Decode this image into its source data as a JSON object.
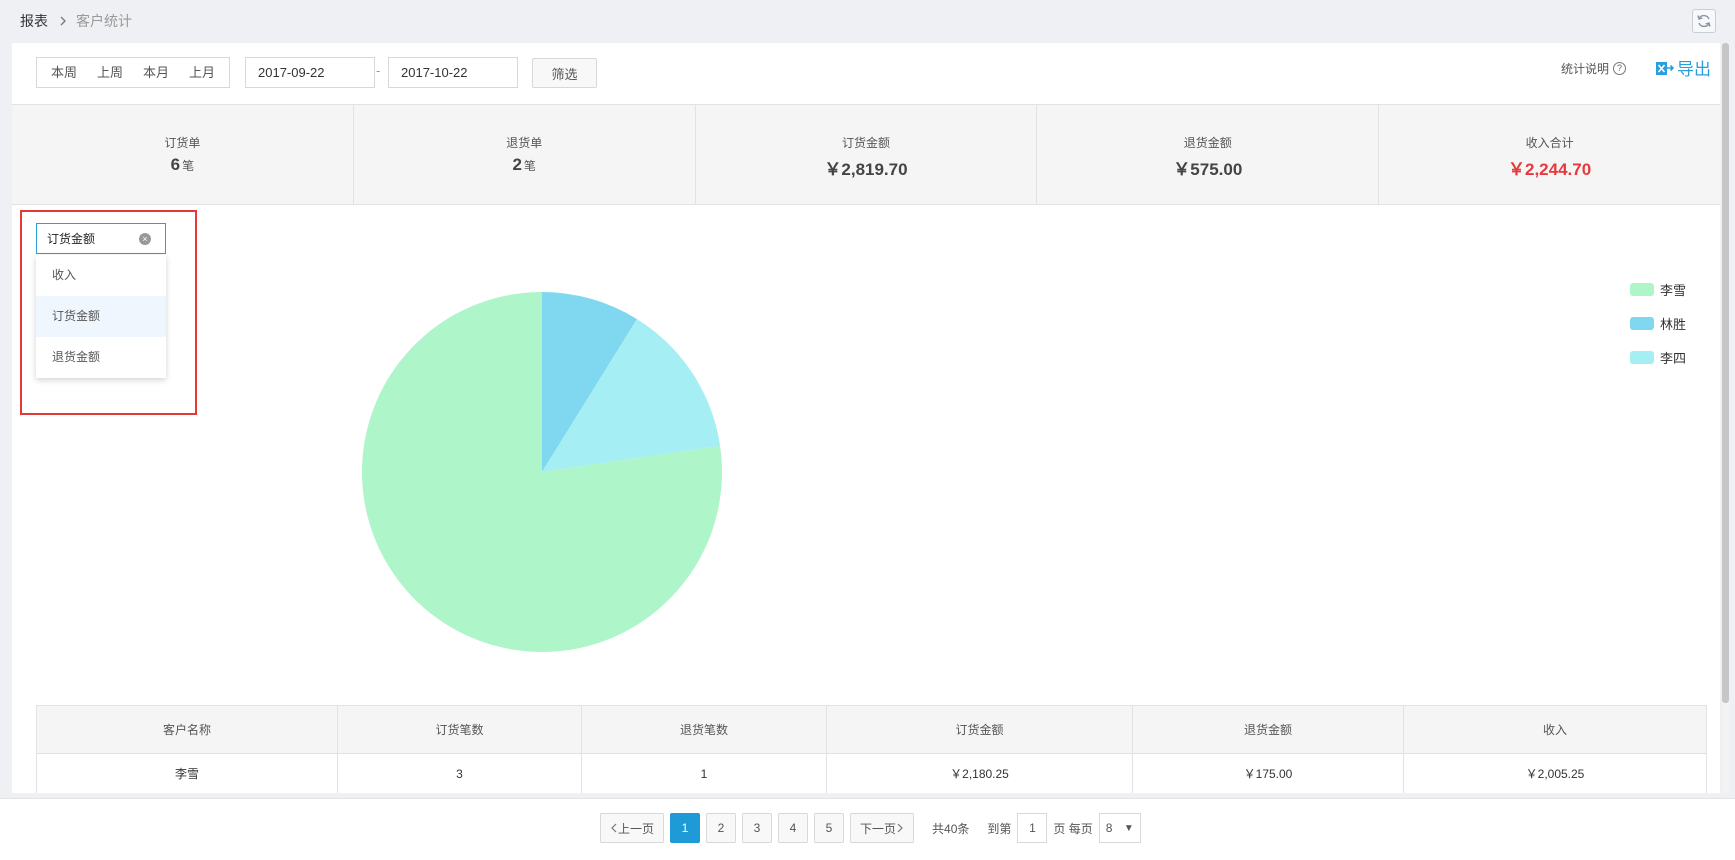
{
  "breadcrumb": {
    "home": "报表",
    "current": "客户统计"
  },
  "icons": {
    "refresh": "refresh-icon",
    "help": "help-icon",
    "export": "export-icon",
    "clear": "clear-icon"
  },
  "filters": {
    "periods": [
      "本周",
      "上周",
      "本月",
      "上月"
    ],
    "start_date": "2017-09-22",
    "end_date": "2017-10-22",
    "dash": "-",
    "filter_label": "筛选"
  },
  "toolbar": {
    "explain_label": "统计说明",
    "help_glyph": "?",
    "export_label": "导出"
  },
  "stats": [
    {
      "label": "订货单",
      "value": "6",
      "unit": "笔",
      "highlight": false
    },
    {
      "label": "退货单",
      "value": "2",
      "unit": "笔",
      "highlight": false
    },
    {
      "label": "订货金额",
      "value": "￥2,819.70",
      "unit": "",
      "highlight": false
    },
    {
      "label": "退货金额",
      "value": "￥575.00",
      "unit": "",
      "highlight": false
    },
    {
      "label": "收入合计",
      "value": "￥2,244.70",
      "unit": "",
      "highlight": true
    }
  ],
  "metric_select": {
    "selected": "订货金额",
    "options": [
      "收入",
      "订货金额",
      "退货金额"
    ]
  },
  "colors": {
    "accent": "#2a9fdc",
    "red": "#e8383d",
    "highlight_box": "#e53935"
  },
  "chart_data": {
    "type": "pie",
    "labels": [
      "李雪",
      "林胜",
      "李四"
    ],
    "values": [
      2180.25,
      249.45,
      390.0
    ],
    "colors": [
      "#aef5c9",
      "#80d8f0",
      "#a5eef4"
    ]
  },
  "table": {
    "headers": [
      "客户名称",
      "订货笔数",
      "退货笔数",
      "订货金额",
      "退货金额",
      "收入"
    ],
    "rows": [
      [
        "李雪",
        "3",
        "1",
        "￥2,180.25",
        "￥175.00",
        "￥2,005.25"
      ]
    ]
  },
  "pager": {
    "prev": "上一页",
    "next": "下一页",
    "pages": [
      "1",
      "2",
      "3",
      "4",
      "5"
    ],
    "current_page": "1",
    "total": "共40条",
    "goto_label": "到第",
    "goto_value": "1",
    "per_page_label": "页 每页",
    "page_size": "8"
  }
}
